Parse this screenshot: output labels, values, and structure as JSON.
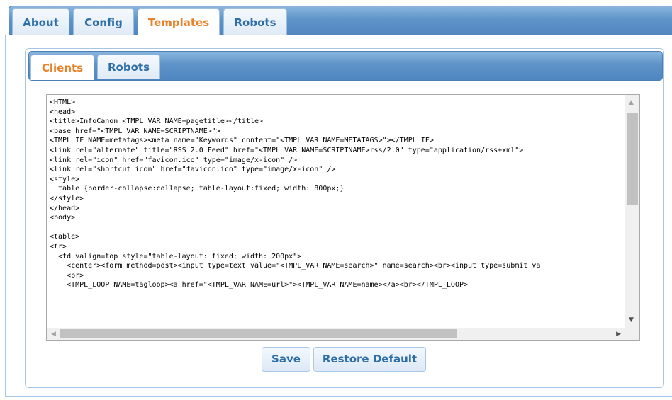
{
  "outer_tabs": [
    {
      "label": "About",
      "active": false
    },
    {
      "label": "Config",
      "active": false
    },
    {
      "label": "Templates",
      "active": true
    },
    {
      "label": "Robots",
      "active": false
    }
  ],
  "inner_tabs": [
    {
      "label": "Clients",
      "active": true
    },
    {
      "label": "Robots",
      "active": false
    }
  ],
  "editor": {
    "content": "<HTML>\n<head>\n<title>InfoCanon <TMPL_VAR NAME=pagetitle></title>\n<base href=\"<TMPL_VAR NAME=SCRIPTNAME>\">\n<TMPL_IF NAME=metatags><meta name=\"Keywords\" content=\"<TMPL_VAR NAME=METATAGS>\"></TMPL_IF>\n<link rel=\"alternate\" title=\"RSS 2.0 Feed\" href=\"<TMPL_VAR NAME=SCRIPTNAME>rss/2.0\" type=\"application/rss+xml\">\n<link rel=\"icon\" href=\"favicon.ico\" type=\"image/x-icon\" />\n<link rel=\"shortcut icon\" href=\"favicon.ico\" type=\"image/x-icon\" />\n<style>\n  table {border-collapse:collapse; table-layout:fixed; width: 800px;}\n</style>\n</head>\n<body>\n\n<table>\n<tr>\n  <td valign=top style=\"table-layout: fixed; width: 200px\">\n    <center><form method=post><input type=text value=\"<TMPL_VAR NAME=search>\" name=search><br><input type=submit va\n    <br>\n    <TMPL_LOOP NAME=tagloop><a href=\"<TMPL_VAR NAME=url>\"><TMPL_VAR NAME=name></a><br></TMPL_LOOP>"
  },
  "buttons": {
    "save": "Save",
    "restore": "Restore Default"
  },
  "icons": {
    "scroll_up": "▲",
    "scroll_down": "▼",
    "scroll_left": "◀",
    "scroll_right": "▶"
  },
  "colors": {
    "tab_bar": "#5e93c8",
    "active_tab_text": "#e8822a",
    "tab_text": "#2e6ea6"
  }
}
